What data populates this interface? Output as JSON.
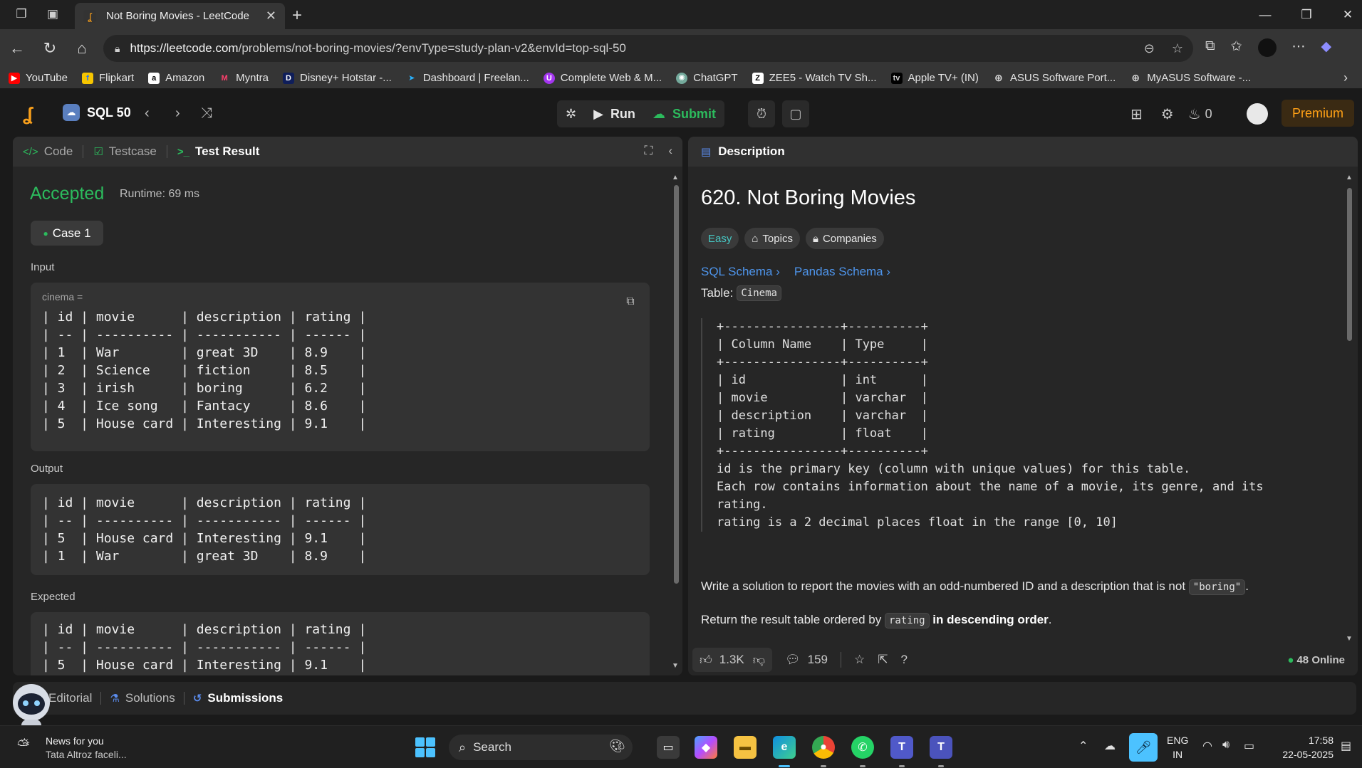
{
  "browser": {
    "tab_title": "Not Boring Movies - LeetCode",
    "url_host": "https://leetcode.com",
    "url_path": "/problems/not-boring-movies/?envType=study-plan-v2&envId=top-sql-50"
  },
  "bookmarks": [
    {
      "label": "YouTube",
      "color": "#ff0000",
      "icon": "youtube-icon"
    },
    {
      "label": "Flipkart",
      "color": "#f7c600",
      "icon": "flipkart-icon"
    },
    {
      "label": "Amazon",
      "color": "#ffffff",
      "icon": "amazon-icon"
    },
    {
      "label": "Myntra",
      "color": "#ff3f6c",
      "icon": "myntra-icon"
    },
    {
      "label": "Disney+ Hotstar -...",
      "color": "#0f1e5a",
      "icon": "hotstar-icon"
    },
    {
      "label": "Dashboard | Freelan...",
      "color": "#29b2fe",
      "icon": "freelancer-icon"
    },
    {
      "label": "Complete Web & M...",
      "color": "#a435f0",
      "icon": "udemy-icon"
    },
    {
      "label": "ChatGPT",
      "color": "#74aa9c",
      "icon": "chatgpt-icon"
    },
    {
      "label": "ZEE5 - Watch TV Sh...",
      "color": "#ffffff",
      "icon": "zee5-icon"
    },
    {
      "label": "Apple TV+ (IN)",
      "color": "#000000",
      "icon": "appletv-icon"
    },
    {
      "label": "ASUS Software Port...",
      "color": "#555555",
      "icon": "globe-icon"
    },
    {
      "label": "MyASUS Software -...",
      "color": "#555555",
      "icon": "globe-icon"
    }
  ],
  "lcnav": {
    "plan_label": "SQL 50",
    "run_label": "Run",
    "submit_label": "Submit",
    "streak_count": "0",
    "premium_label": "Premium"
  },
  "left": {
    "tabs": [
      "Code",
      "Testcase",
      "Test Result"
    ],
    "status": "Accepted",
    "runtime": "Runtime: 69 ms",
    "case_label": "Case 1",
    "input_label": "Input",
    "input_var": "cinema =",
    "input_table": "| id | movie      | description | rating |\n| -- | ---------- | ----------- | ------ |\n| 1  | War        | great 3D    | 8.9    |\n| 2  | Science    | fiction     | 8.5    |\n| 3  | irish      | boring      | 6.2    |\n| 4  | Ice song   | Fantacy     | 8.6    |\n| 5  | House card | Interesting | 9.1    |",
    "output_label": "Output",
    "output_table": "| id | movie      | description | rating |\n| -- | ---------- | ----------- | ------ |\n| 5  | House card | Interesting | 9.1    |\n| 1  | War        | great 3D    | 8.9    |",
    "expected_label": "Expected",
    "expected_table": "| id | movie      | description | rating |\n| -- | ---------- | ----------- | ------ |\n| 5  | House card | Interesting | 9.1    |"
  },
  "right": {
    "tab": "Description",
    "title": "620. Not Boring Movies",
    "difficulty": "Easy",
    "topics": "Topics",
    "companies": "Companies",
    "sql_schema": "SQL Schema",
    "pandas_schema": "Pandas Schema",
    "table_prefix": "Table:",
    "table_name": "Cinema",
    "schema_text": "+----------------+----------+\n| Column Name    | Type     |\n+----------------+----------+\n| id             | int      |\n| movie          | varchar  |\n| description    | varchar  |\n| rating         | float    |\n+----------------+----------+\nid is the primary key (column with unique values) for this table.\nEach row contains information about the name of a movie, its genre, and its\nrating.\nrating is a 2 decimal places float in the range [0, 10]",
    "para1_pre": "Write a solution to report the movies with an odd-numbered ID and a description that is not ",
    "para1_code": "\"boring\"",
    "para1_post": ".",
    "para2_pre": "Return the result table ordered by ",
    "para2_code": "rating",
    "para2_bold": "in descending order",
    "para2_post": ".",
    "likes": "1.3K",
    "comments": "159",
    "online": "48 Online"
  },
  "bottom": {
    "tabs": [
      "Editorial",
      "Solutions",
      "Submissions"
    ]
  },
  "taskbar": {
    "news_title": "News for you",
    "news_sub": "Tata Altroz faceli...",
    "search": "Search",
    "lang1": "ENG",
    "lang2": "IN",
    "time": "17:58",
    "date": "22-05-2025"
  }
}
